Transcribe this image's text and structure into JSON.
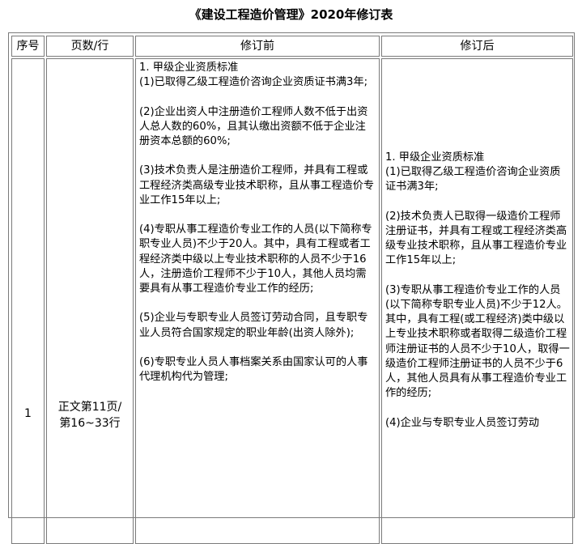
{
  "title": "《建设工程造价管理》2020年修订表",
  "headers": {
    "seq": "序号",
    "page_line": "页数/行",
    "before": "修订前",
    "after": "修订后"
  },
  "row": {
    "seq": "1",
    "page_line_1": "正文第11页/",
    "page_line_2": "第16~33行",
    "before": [
      "1. 甲级企业资质标准\n(1)已取得乙级工程造价咨询企业资质证书满3年;",
      "(2)企业出资人中注册造价工程师人数不低于出资人总人数的60%，且其认缴出资额不低于企业注册资本总额的60%;",
      "(3)技术负责人是注册造价工程师，并具有工程或工程经济类高级专业技术职称，且从事工程造价专业工作15年以上;",
      "(4)专职从事工程造价专业工作的人员(以下简称专职专业人员)不少于20人。其中，具有工程或者工程经济类中级以上专业技术职称的人员不少于16人，注册造价工程师不少于10人，其他人员均需要具有从事工程造价专业工作的经历;",
      "(5)企业与专职专业人员签订劳动合同，且专职专业人员符合国家规定的职业年龄(出资人除外);",
      "(6)专职专业人员人事档案关系由国家认可的人事代理机构代为管理;"
    ],
    "after": [
      "1. 甲级企业资质标准\n(1)已取得乙级工程造价咨询企业资质证书满3年;",
      "(2)技术负责人已取得一级造价工程师注册证书，并具有工程或工程经济类高级专业技术职称，且从事工程造价专业工作15年以上;",
      "(3)专职从事工程造价专业工作的人员(以下简称专职专业人员)不少于12人。其中，具有工程(或工程经济)类中级以上专业技术职称或者取得二级造价工程师注册证书的人员不少于10人，取得一级造价工程师注册证书的人员不少于6人，其他人员具有从事工程造价专业工作的经历;",
      "(4)企业与专职专业人员签订劳动"
    ]
  }
}
